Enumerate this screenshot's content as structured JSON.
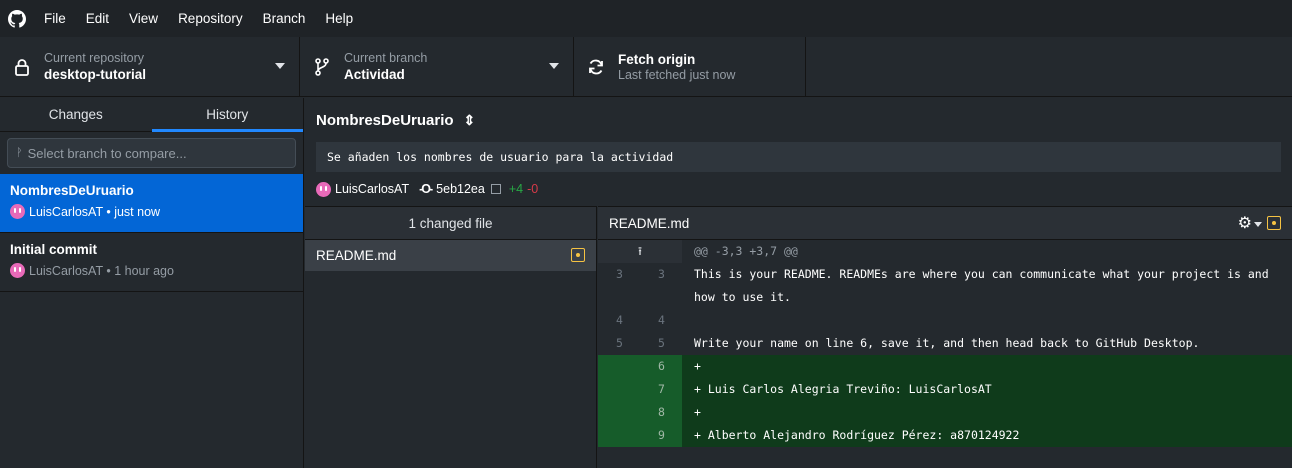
{
  "menu": [
    "File",
    "Edit",
    "View",
    "Repository",
    "Branch",
    "Help"
  ],
  "toolbar": {
    "repo_label": "Current repository",
    "repo_value": "desktop-tutorial",
    "branch_label": "Current branch",
    "branch_value": "Actividad",
    "fetch_label": "Fetch origin",
    "fetch_sub": "Last fetched just now"
  },
  "sidebar": {
    "tabs": [
      "Changes",
      "History"
    ],
    "branch_filter_placeholder": "Select branch to compare...",
    "commits": [
      {
        "title": "NombresDeUruario",
        "author": "LuisCarlosAT",
        "time": "just now",
        "meta": "LuisCarlosAT • just now"
      },
      {
        "title": "Initial commit",
        "author": "LuisCarlosAT",
        "time": "1 hour ago",
        "meta": "LuisCarlosAT • 1 hour ago"
      }
    ]
  },
  "commit": {
    "title": "NombresDeUruario",
    "description": "Se añaden los nombres de usuario para la actividad",
    "author": "LuisCarlosAT",
    "sha": "5eb12ea",
    "additions": "+4",
    "deletions": "-0"
  },
  "files": {
    "header": "1 changed file",
    "items": [
      "README.md"
    ]
  },
  "diff": {
    "file": "README.md",
    "hunk": "@@ -3,3 +3,7 @@",
    "lines": [
      {
        "old": "3",
        "new": "3",
        "type": "ctx",
        "text": "This is your README. READMEs are where you can communicate what your project is and how to use it."
      },
      {
        "old": "4",
        "new": "4",
        "type": "ctx",
        "text": ""
      },
      {
        "old": "5",
        "new": "5",
        "type": "ctx",
        "text": "Write your name on line 6, save it, and then head back to GitHub Desktop."
      },
      {
        "old": "",
        "new": "6",
        "type": "add",
        "text": "+"
      },
      {
        "old": "",
        "new": "7",
        "type": "add",
        "text": "+ Luis Carlos Alegria Treviño: LuisCarlosAT"
      },
      {
        "old": "",
        "new": "8",
        "type": "add",
        "text": "+"
      },
      {
        "old": "",
        "new": "9",
        "type": "add",
        "text": "+ Alberto Alejandro Rodríguez Pérez: a870124922"
      }
    ]
  },
  "colors": {
    "accent": "#0366d6",
    "tab_underline": "#2188ff",
    "added": "#28a745",
    "deleted": "#d73a49",
    "modified": "#f6c343",
    "avatar": "#e86ab9"
  }
}
